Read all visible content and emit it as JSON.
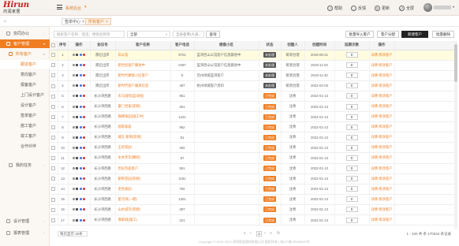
{
  "brand": {
    "logo_main": "Hirun",
    "logo_sub": "鸿润家居"
  },
  "topbar": {
    "system_name": "系统后台",
    "actions": [
      {
        "label": "帮助",
        "icon": "help-icon",
        "glyph": "?"
      },
      {
        "label": "反馈",
        "icon": "feedback-icon",
        "glyph": "…"
      },
      {
        "label": "更新",
        "icon": "refresh-icon",
        "glyph": "↻"
      },
      {
        "label": "全屏",
        "icon": "fullscreen-icon",
        "glyph": "⤢"
      }
    ]
  },
  "tabs": {
    "home": "首页",
    "items": [
      {
        "label": "签单中心",
        "active": false
      },
      {
        "label": "所有客户",
        "active": true
      }
    ]
  },
  "sidebar": {
    "items": [
      {
        "label": "协同办公",
        "level": "top",
        "icon": "office-icon",
        "expanded": false
      },
      {
        "label": "客户管理",
        "level": "top",
        "icon": "customer-icon",
        "expanded": true,
        "current": true
      },
      {
        "label": "所有客户",
        "level": "sub",
        "icon": "folder-icon",
        "expanded": true
      },
      {
        "label": "跟进客户",
        "level": "leaf",
        "active": true
      },
      {
        "label": "意向客户",
        "level": "leaf"
      },
      {
        "label": "报备客户",
        "level": "leaf"
      },
      {
        "label": "上门设计客户",
        "level": "leaf"
      },
      {
        "label": "设计客户",
        "level": "leaf"
      },
      {
        "label": "签单客户",
        "level": "leaf"
      },
      {
        "label": "施工客户",
        "level": "leaf"
      },
      {
        "label": "竣工客户",
        "level": "leaf"
      },
      {
        "label": "合作伙伴",
        "level": "leaf"
      },
      {
        "label": "我的任务",
        "level": "top2",
        "icon": "task-icon",
        "expanded": false
      }
    ],
    "bottom": [
      {
        "label": "设计管理",
        "icon": "design-icon"
      },
      {
        "label": "报表管理",
        "icon": "report-icon"
      }
    ]
  },
  "filters": {
    "search_placeholder": "搜索客户名称、电话、楼盘名称等",
    "select_all": "全部",
    "search_text": "全员名单(人员...",
    "search_button": "查询",
    "buttons": [
      "批量导入客户",
      "客户分配",
      "新建客户",
      "批量删除"
    ]
  },
  "table": {
    "columns": [
      "",
      "序号",
      "操作",
      "协议号",
      "客户名称",
      "客户电话",
      "楼盘小区",
      "状态",
      "创建人",
      "创建时间",
      "延期次数",
      "操作"
    ],
    "rows": [
      {
        "seq": "1",
        "proto": "腾启出库",
        "name": "白公馆",
        "phone": "9701",
        "building": "蓝湾西山公馆客户信息跟进中",
        "status": "未处理",
        "creator": "蒋周治理",
        "date": "2018-08-21",
        "count": "0",
        "highlight": true
      },
      {
        "seq": "2",
        "proto": "腾启出库",
        "name": "新世纪客户跟进中",
        "phone": "0497",
        "building": "蓝湾西山公馆客户信息跟进中",
        "status": "未处理",
        "creator": "蒋周治理",
        "date": "2018-11-03",
        "count": "0"
      },
      {
        "seq": "3",
        "proto": "腾启出库",
        "name": "新时代楼盘小区客户",
        "phone": "8",
        "building": "苏州绿城蓝湾客户",
        "status": "未处理",
        "creator": "蒋周治理",
        "date": "2018-11-30",
        "count": "0"
      },
      {
        "seq": "4",
        "proto": "腾启出库",
        "name": "新时代客户跟进信息",
        "phone": "487",
        "building": "杭州绿城客户资料",
        "status": "未处理",
        "creator": "蒋周治理",
        "date": "2022-02-03",
        "count": "0"
      },
      {
        "seq": "5",
        "proto": "长沙湾西路",
        "name": "天马国际(蓝海组)",
        "phone": "951",
        "building": "",
        "status": "已完成",
        "creator": "沈青",
        "date": "2022-01-13",
        "count": "0"
      },
      {
        "seq": "6",
        "proto": "长沙湾西路",
        "name": "豪门世家(装修)",
        "phone": "451",
        "building": "",
        "status": "已完成",
        "creator": "沈青",
        "date": "2022-01-13",
        "count": "0"
      },
      {
        "seq": "7",
        "proto": "长沙湾西路",
        "name": "锦绣家园(施工中)",
        "phone": "1241",
        "building": "",
        "status": "已完成",
        "creator": "沈青",
        "date": "2022-01-13",
        "count": "0"
      },
      {
        "seq": "8",
        "proto": "长沙湾西路",
        "name": "国际家居",
        "phone": "962",
        "building": "",
        "status": "已完成",
        "creator": "沈青",
        "date": "2022-01-13",
        "count": "0"
      },
      {
        "seq": "9",
        "proto": "长沙湾西路",
        "name": "城东 紫荆(装修)",
        "phone": "91",
        "building": "",
        "status": "已完成",
        "creator": "沈青",
        "date": "2022-01-13",
        "count": "0"
      },
      {
        "seq": "10",
        "proto": "长沙湾西路",
        "name": "王府花园",
        "phone": "492",
        "building": "",
        "status": "已完成",
        "creator": "沈青",
        "date": "2022-01-13",
        "count": "0"
      },
      {
        "seq": "11",
        "proto": "长沙湾西路",
        "name": "水木年华(精装)",
        "phone": "67",
        "building": "",
        "status": "已完成",
        "creator": "沈青",
        "date": "2022-01-13",
        "count": "0"
      },
      {
        "seq": "12",
        "proto": "长沙湾西路",
        "name": "世纪华庭客户",
        "phone": "551",
        "building": "",
        "status": "已完成",
        "creator": "沈青",
        "date": "2022-01-13",
        "count": "0"
      },
      {
        "seq": "13",
        "proto": "长沙湾西路",
        "name": "紫荆花园(装修)",
        "phone": "1181",
        "building": "",
        "status": "已完成",
        "creator": "沈青",
        "date": "2022-01-13",
        "count": "0"
      },
      {
        "seq": "14",
        "proto": "长沙湾西路",
        "name": "金色家园",
        "phone": "782",
        "building": "",
        "status": "已完成",
        "creator": "沈青",
        "date": "2022-01-13",
        "count": "0"
      },
      {
        "seq": "15",
        "proto": "长沙湾西路",
        "name": "星河湾(一期)",
        "phone": "1251",
        "building": "",
        "status": "已完成",
        "creator": "沈青",
        "date": "2022-01-13",
        "count": "0"
      },
      {
        "seq": "16",
        "proto": "长沙湾西路",
        "name": "山水城市(装修)",
        "phone": "397",
        "building": "",
        "status": "已完成",
        "creator": "沈青",
        "date": "2022-01-13",
        "count": "0"
      },
      {
        "seq": "17",
        "proto": "长沙湾西路",
        "name": "翡翠城(施工)",
        "phone": "221",
        "building": "",
        "status": "已完成",
        "creator": "沈青",
        "date": "2022-01-13",
        "count": "0"
      }
    ],
    "action_links": [
      "详情",
      "修改客户"
    ]
  },
  "pager": {
    "page_size": "每页显示 20条",
    "page": "1",
    "info": "1 - 100 共 条 170334 条记录"
  },
  "footer": "Copyright © 2010-2022 鸿润家居建材有限公司 版权所有 | 浙ICP备 00000000号",
  "colors": {
    "accent": "#ef7d22",
    "pending": "#555555",
    "done": "#ef7d22"
  }
}
